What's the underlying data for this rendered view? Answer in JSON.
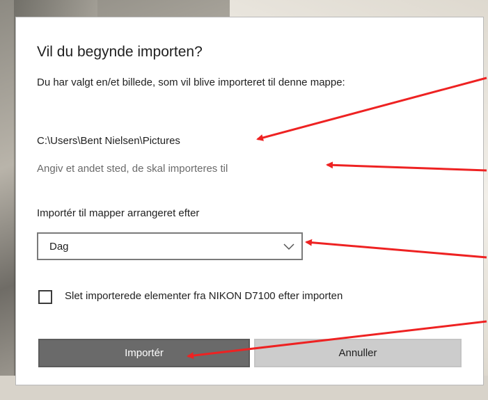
{
  "dialog": {
    "title": "Vil du begynde importen?",
    "description": "Du har valgt en/et billede, som vil blive importeret til denne mappe:",
    "destination_path": "C:\\Users\\Bent Nielsen\\Pictures",
    "change_location_link": "Angiv et andet sted, de skal importeres til",
    "arrange_label": "Importér til mapper arrangeret efter",
    "arrange_selected": "Dag",
    "delete_checkbox_label": "Slet importerede elementer fra NIKON D7100 efter importen",
    "delete_checked": false,
    "import_button": "Importér",
    "cancel_button": "Annuller"
  },
  "annotations": {
    "arrow_color": "#ee2222",
    "count": 4
  },
  "icons": [
    "chevron-down-icon",
    "checkbox-icon",
    "annotation-arrow-icon"
  ]
}
